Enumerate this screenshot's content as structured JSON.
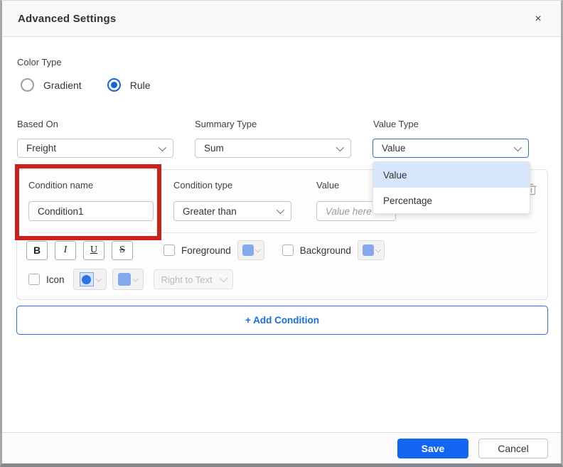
{
  "dialog": {
    "title": "Advanced Settings"
  },
  "icons": {
    "close": "×"
  },
  "color_type": {
    "label": "Color Type",
    "options": [
      {
        "label": "Gradient",
        "selected": false
      },
      {
        "label": "Rule",
        "selected": true
      }
    ]
  },
  "fields": {
    "based_on": {
      "label": "Based On",
      "value": "Freight"
    },
    "summary_type": {
      "label": "Summary Type",
      "value": "Sum"
    },
    "value_type": {
      "label": "Value Type",
      "value": "Value",
      "options": [
        "Value",
        "Percentage"
      ],
      "selected_option": "Value",
      "dropdown_open": true
    }
  },
  "condition": {
    "name": {
      "label": "Condition name",
      "value": "Condition1"
    },
    "type": {
      "label": "Condition type",
      "value": "Greater than"
    },
    "value": {
      "label": "Value",
      "placeholder": "Value here"
    },
    "format": {
      "bold": "B",
      "italic": "I",
      "underline": "U",
      "strikethrough": "S",
      "foreground_label": "Foreground",
      "background_label": "Background"
    },
    "icon": {
      "label": "Icon",
      "position_value": "Right to Text"
    }
  },
  "add_condition_label": "+ Add Condition",
  "footer": {
    "save_label": "Save",
    "cancel_label": "Cancel"
  },
  "colors": {
    "accent_blue": "#1266f1",
    "focus_border_blue": "#2d6be5",
    "swatch_blue": "#86a9ee",
    "icon_circle_blue": "#2f72e4",
    "popup_highlight": "#d8e6fb",
    "annotation_red": "#cb201c"
  }
}
